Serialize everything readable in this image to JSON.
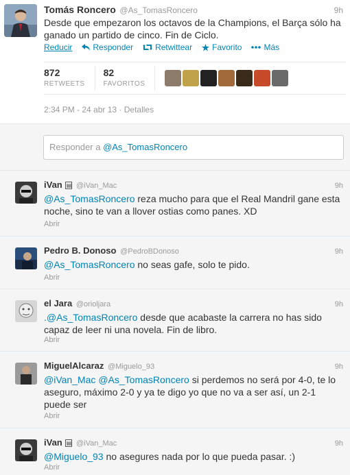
{
  "main_tweet": {
    "fullname": "Tomás Roncero",
    "username": "@As_TomasRoncero",
    "time": "9h",
    "text": "Desde que empezaron los octavos de la Champions, el Barça sólo ha ganado un partido de cinco. Fin de Ciclo.",
    "actions": {
      "reducir": "Reducir",
      "responder": "Responder",
      "retwittear": "Retwittear",
      "favorito": "Favorito",
      "mas": "Más"
    },
    "retweets_count": "872",
    "retweets_label": "RETWEETS",
    "favorites_count": "82",
    "favorites_label": "FAVORITOS",
    "timestamp": "2:34 PM - 24 abr 13",
    "detalles": "Detalles",
    "faces_colors": [
      "#8c7b6a",
      "#c0a24b",
      "#222222",
      "#a06a3a",
      "#3a2a1a",
      "#c74a2a",
      "#6a6a6a"
    ]
  },
  "reply_box": {
    "prefix": "Responder a ",
    "mention": "@As_TomasRoncero"
  },
  "replies": [
    {
      "fullname": "iVan",
      "badge": "🂠",
      "username": "@iVan_Mac",
      "time": "9h",
      "mention": "@As_TomasRoncero",
      "text": " reza mucho para que el Real Mandril gane esta noche, sino te van a llover ostias como panes. XD",
      "open": "Abrir"
    },
    {
      "fullname": "Pedro B. Donoso",
      "username": "@PedroBDonoso",
      "time": "9h",
      "mention": "@As_TomasRoncero",
      "text": " no seas gafe, solo te pido.",
      "open": "Abrir"
    },
    {
      "fullname": "el Jara",
      "username": "@orioljara",
      "time": "9h",
      "prefix": ".",
      "mention": "@As_TomasRoncero",
      "text": " desde que acabaste la carrera no has sido capaz de leer ni una novela. Fin de libro.",
      "open": "Abrir"
    },
    {
      "fullname": "MiguelAlcaraz",
      "username": "@Miguelo_93",
      "time": "9h",
      "mention": "@iVan_Mac",
      "mention2": "@As_TomasRoncero",
      "text": " si perdemos no será por 4-0, te lo aseguro, máximo 2-0  y ya te digo yo que no va a ser así, un 2-1 puede ser",
      "open": "Abrir"
    },
    {
      "fullname": "iVan",
      "badge": "🂠",
      "username": "@iVan_Mac",
      "time": "9h",
      "mention": "@Miguelo_93",
      "text": " no asegures nada por lo que pueda pasar. :)",
      "open": "Abrir"
    }
  ]
}
